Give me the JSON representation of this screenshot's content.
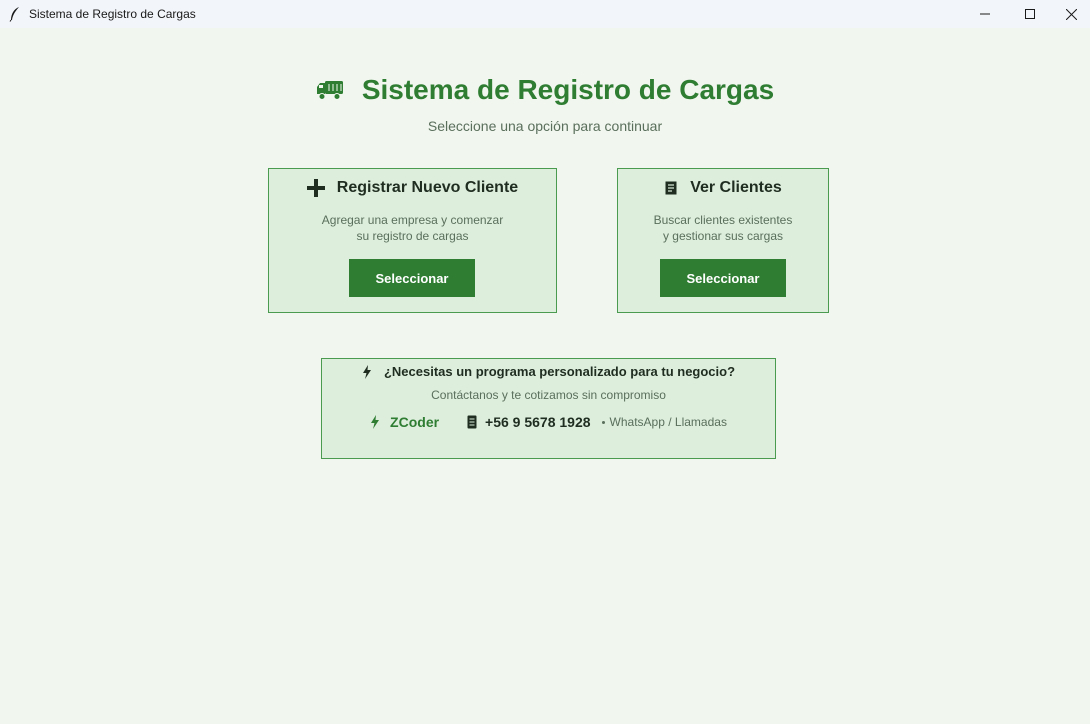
{
  "window": {
    "title": "Sistema de Registro de Cargas",
    "app_icon": "feather-icon",
    "controls": [
      "minimize-icon",
      "maximize-icon",
      "close-icon"
    ]
  },
  "header": {
    "icon": "truck-icon",
    "title": "Sistema de Registro de Cargas",
    "subtitle": "Seleccione una opción para continuar"
  },
  "cards": {
    "register": {
      "icon": "plus-icon",
      "title": "Registrar Nuevo Cliente",
      "desc_line1": "Agregar una empresa y comenzar",
      "desc_line2": "su registro de cargas",
      "button": "Seleccionar"
    },
    "view": {
      "icon": "document-icon",
      "title": "Ver Clientes",
      "desc_line1": "Buscar clientes existentes",
      "desc_line2": "y gestionar sus cargas",
      "button": "Seleccionar"
    }
  },
  "promo": {
    "icon": "lightning-icon",
    "title": "¿Necesitas un programa personalizado para tu negocio?",
    "subtitle": "Contáctanos y te cotizamos sin compromiso",
    "brand": "ZCoder",
    "phone": "+56 9 5678 1928",
    "contact_note": "WhatsApp / Llamadas"
  },
  "colors": {
    "background": "#f1f6ee",
    "accent": "#2e7d32",
    "card_bg": "#ddeedd",
    "card_border": "#4a9a4f",
    "text_dark": "#1f2d20",
    "text_muted": "#5a6f5c"
  }
}
